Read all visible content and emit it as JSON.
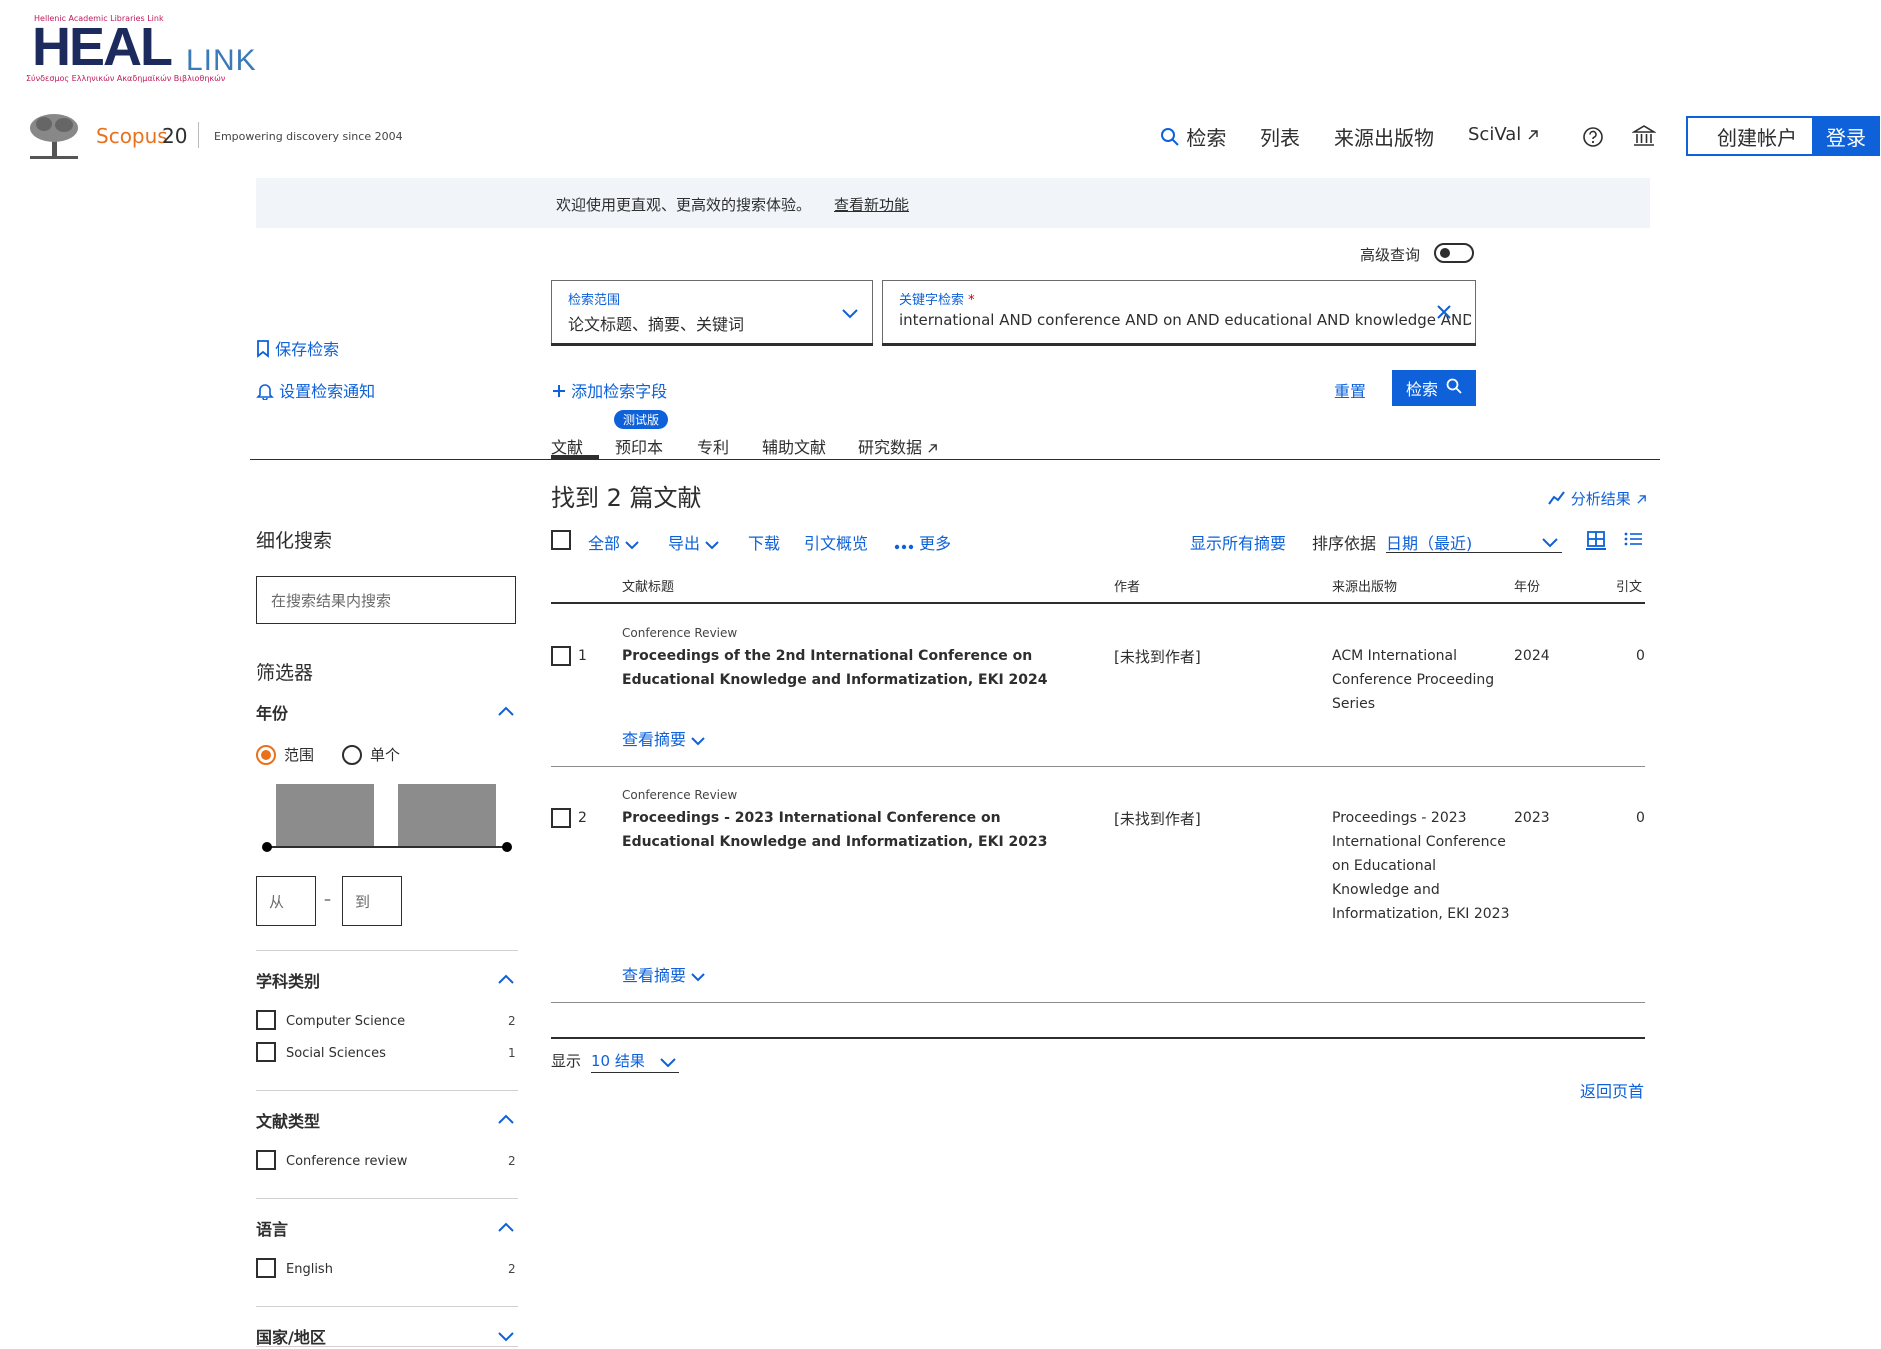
{
  "heal": {
    "top_line": "Hellenic Academic Libraries Link",
    "big": "HEAL",
    "link": "LINK",
    "sub_line": "Σύνδεσμος Ελληνικών Ακαδημαϊκών Βιβλιοθηκών"
  },
  "header": {
    "brand": "Scopus",
    "brand_num": "20",
    "tagline": "Empowering discovery since 2004",
    "nav": {
      "search": "检索",
      "lists": "列表",
      "sources": "来源出版物",
      "scival": "SciVal"
    },
    "create_account": "创建帐户",
    "login": "登录"
  },
  "banner": {
    "text": "欢迎使用更直观、更高效的搜索体验。",
    "link": "查看新功能"
  },
  "search": {
    "advanced_label": "高级查询",
    "scope_label": "检索范围",
    "scope_value": "论文标题、摘要、关键词",
    "keyword_label": "关键字检索",
    "keyword_required": "*",
    "keyword_value": "international AND conference AND on AND educational AND knowledge AND informatization",
    "add_field": "添加检索字段",
    "reset": "重置",
    "search_button": "检索"
  },
  "side_actions": {
    "save_search": "保存检索",
    "set_alert": "设置检索通知"
  },
  "tabs": {
    "documents": "文献",
    "preprints": "预印本",
    "beta": "测试版",
    "patents": "专利",
    "secondary": "辅助文献",
    "research_data": "研究数据"
  },
  "results": {
    "found": "找到 2 篇文献",
    "analyze": "分析结果",
    "toolbar": {
      "all": "全部",
      "export": "导出",
      "download": "下载",
      "citation_overview": "引文概览",
      "more": "更多",
      "show_all_abstracts": "显示所有摘要",
      "sort_label": "排序依据",
      "sort_value": "日期（最近)"
    },
    "columns": {
      "title": "文献标题",
      "authors": "作者",
      "source": "来源出版物",
      "year": "年份",
      "cited": "引文"
    },
    "rows": [
      {
        "num": "1",
        "type": "Conference Review",
        "title": "Proceedings of the 2nd International Conference on Educational Knowledge and Informatization, EKI 2024",
        "authors": "[未找到作者]",
        "source": "ACM International Conference Proceeding Series",
        "year": "2024",
        "cited": "0",
        "abstract_link": "查看摘要"
      },
      {
        "num": "2",
        "type": "Conference Review",
        "title": "Proceedings - 2023 International Conference on Educational Knowledge and Informatization, EKI 2023",
        "authors": "[未找到作者]",
        "source": "Proceedings - 2023 International Conference on Educational Knowledge and Informatization, EKI 2023",
        "year": "2023",
        "cited": "0",
        "abstract_link": "查看摘要"
      }
    ],
    "show_label": "显示",
    "show_value": "10 结果",
    "back_to_top": "返回页首"
  },
  "sidebar": {
    "refine_title": "细化搜索",
    "refine_placeholder": "在搜索结果内搜索",
    "filters_title": "筛选器",
    "year": {
      "title": "年份",
      "range": "范围",
      "single": "单个",
      "from_placeholder": "从",
      "dash": "–",
      "to_placeholder": "到",
      "histogram": [
        1,
        1
      ]
    },
    "subject": {
      "title": "学科类别",
      "items": [
        {
          "label": "Computer Science",
          "count": "2"
        },
        {
          "label": "Social Sciences",
          "count": "1"
        }
      ]
    },
    "doctype": {
      "title": "文献类型",
      "items": [
        {
          "label": "Conference review",
          "count": "2"
        }
      ]
    },
    "language": {
      "title": "语言",
      "items": [
        {
          "label": "English",
          "count": "2"
        }
      ]
    },
    "country": {
      "title": "国家/地区"
    }
  },
  "colors": {
    "accent_blue": "#0e61d8",
    "scopus_orange": "#e9711c"
  }
}
